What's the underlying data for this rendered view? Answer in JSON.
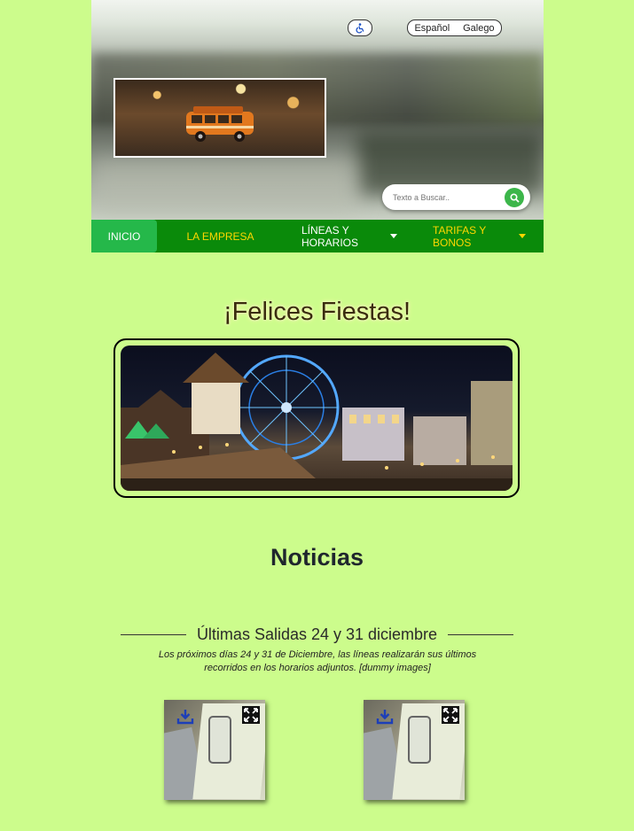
{
  "header": {
    "accessibility_icon": "wheelchair-icon",
    "languages": [
      "Español",
      "Galego"
    ],
    "search": {
      "placeholder": "Texto a Buscar..",
      "icon": "search-icon"
    }
  },
  "nav": {
    "items": [
      {
        "label": "INICIO"
      },
      {
        "label": "LA EMPRESA"
      },
      {
        "label": "LÍNEAS Y HORARIOS"
      },
      {
        "label": "TARIFAS Y BONOS"
      }
    ]
  },
  "main": {
    "greeting": "¡Felices Fiestas!",
    "section_title": "Noticias",
    "news": {
      "title": "Últimas Salidas 24 y 31 diciembre",
      "description": "Los próximos días 24 y 31 de Diciembre, las líneas realizarán sus últimos recorridos en los horarios adjuntos. [dummy images]",
      "thumb_icons": [
        "download-icon",
        "expand-icon"
      ]
    }
  },
  "colors": {
    "nav_bg": "#0a8a0a",
    "nav_active": "#25b84a",
    "nav_text": "#ffd700",
    "page_bg": "#ccfc8c"
  }
}
